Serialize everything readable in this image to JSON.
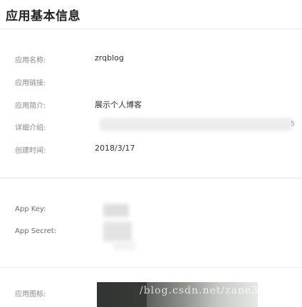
{
  "page": {
    "title": "应用基本信息"
  },
  "basic_info": {
    "rows": [
      {
        "label": "应用名称:",
        "value": "zrqblog"
      },
      {
        "label": "应用链接:",
        "value": ""
      },
      {
        "label": "应用简介:",
        "value": "展示个人博客"
      },
      {
        "label": "详细介绍:",
        "value": ""
      },
      {
        "label": "创建时间:",
        "value": "2018/3/17"
      }
    ],
    "detail_tail": "5"
  },
  "credentials": {
    "app_key_label": "App Key:",
    "app_secret_label": "App Secret:"
  },
  "icon_section": {
    "label": "应用图标:",
    "watermark": "/blog.csdn.net/zane3"
  },
  "colors": {
    "background": "#ffffff",
    "label_text": "#8a8a8a",
    "value_text": "#333333",
    "divider": "#e6e6e6"
  }
}
